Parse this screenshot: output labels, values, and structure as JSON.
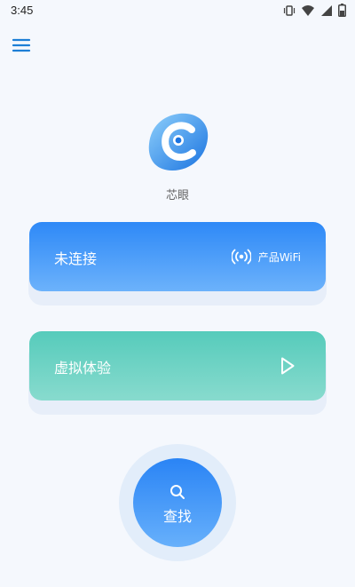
{
  "status_bar": {
    "time": "3:45",
    "icons": [
      "vibrate-icon",
      "wifi-signal-icon",
      "signal-icon",
      "battery-icon"
    ]
  },
  "header": {
    "menu_icon": "menu-icon"
  },
  "app": {
    "name": "芯眼",
    "logo_icon": "app-logo-icon"
  },
  "connection_card": {
    "status": "未连接",
    "wifi_label": "产品WiFi",
    "wifi_icon": "wifi-broadcast-icon"
  },
  "demo_card": {
    "label": "虚拟体验",
    "icon": "play-icon"
  },
  "search_button": {
    "label": "查找",
    "icon": "search-icon"
  },
  "colors": {
    "background": "#f5f8fd",
    "accent_blue": "#2e89f7",
    "accent_teal": "#56cbbb",
    "menu_blue": "#1d7fd6"
  }
}
